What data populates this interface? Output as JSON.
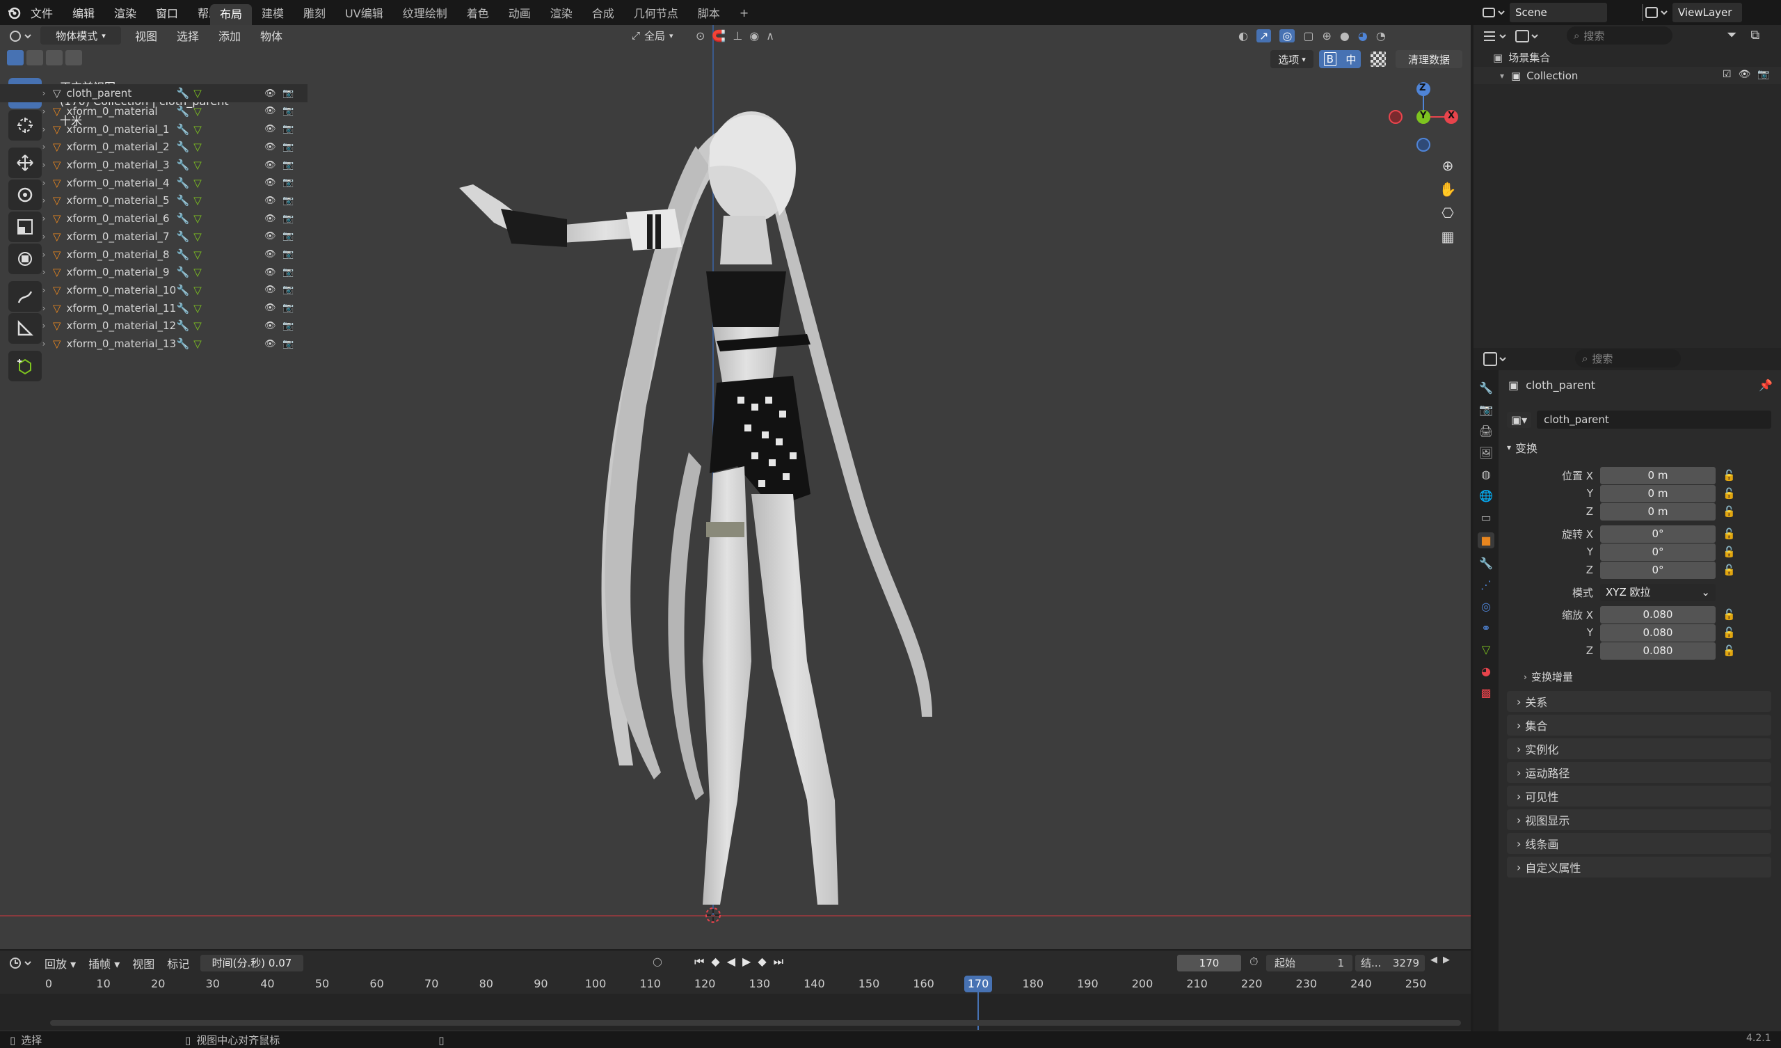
{
  "topbar": {
    "menus": [
      "文件",
      "编辑",
      "渲染",
      "窗口",
      "帮助"
    ],
    "workspaces": [
      "布局",
      "建模",
      "雕刻",
      "UV编辑",
      "纹理绘制",
      "着色",
      "动画",
      "渲染",
      "合成",
      "几何节点",
      "脚本"
    ],
    "active_workspace": "布局",
    "scene": "Scene",
    "view_layer": "ViewLayer",
    "add_tab": "+"
  },
  "viewport": {
    "mode": "物体模式",
    "menus": [
      "视图",
      "选择",
      "添加",
      "物体"
    ],
    "transform_orientation": "全局",
    "view_name": "正交前视图",
    "collection_info": "(170) Collection | cloth_parent",
    "scale_info": "十米",
    "options_label": "选项",
    "b_label": "B",
    "mid_label": "中",
    "purge_label": "清理数据",
    "axes": {
      "x": "X",
      "y": "Y",
      "z": "Z"
    }
  },
  "outliner": {
    "search_placeholder": "搜索",
    "root": "场景集合",
    "collection": "Collection",
    "items": [
      "cloth_parent",
      "xform_0_material",
      "xform_0_material_1",
      "xform_0_material_2",
      "xform_0_material_3",
      "xform_0_material_4",
      "xform_0_material_5",
      "xform_0_material_6",
      "xform_0_material_7",
      "xform_0_material_8",
      "xform_0_material_9",
      "xform_0_material_10",
      "xform_0_material_11",
      "xform_0_material_12",
      "xform_0_material_13"
    ]
  },
  "properties": {
    "search_placeholder": "搜索",
    "object_name": "cloth_parent",
    "data_name": "cloth_parent",
    "transform_title": "变换",
    "location_label": "位置 X",
    "rotation_label": "旋转 X",
    "scale_label": "缩放 X",
    "y_label": "Y",
    "z_label": "Z",
    "location": [
      "0 m",
      "0 m",
      "0 m"
    ],
    "rotation": [
      "0°",
      "0°",
      "0°"
    ],
    "mode_label": "模式",
    "mode_value": "XYZ 欧拉",
    "scale": [
      "0.080",
      "0.080",
      "0.080"
    ],
    "delta": "变换增量",
    "panels": [
      "关系",
      "集合",
      "实例化",
      "运动路径",
      "可见性",
      "视图显示",
      "线条画",
      "自定义属性"
    ]
  },
  "timeline": {
    "playback": "回放",
    "keying": "插帧",
    "view": "视图",
    "marker": "标记",
    "time_display": "时间(分.秒) 0.07",
    "current_frame": "170",
    "start_label": "起始",
    "start_value": "1",
    "end_label": "结...",
    "end_value": "3279",
    "ticks": [
      "0",
      "10",
      "20",
      "30",
      "40",
      "50",
      "60",
      "70",
      "80",
      "90",
      "100",
      "110",
      "120",
      "130",
      "140",
      "150",
      "160",
      "170",
      "180",
      "190",
      "200",
      "210",
      "220",
      "230",
      "240",
      "250"
    ]
  },
  "status": {
    "select": "选择",
    "center_view": "视图中心对齐鼠标",
    "version": "4.2.1"
  },
  "colors": {
    "accent": "#4772b3",
    "x_axis": "#e8444c",
    "y_axis": "#7ec41f",
    "z_axis": "#4f84d6",
    "orange": "#e8861f"
  }
}
